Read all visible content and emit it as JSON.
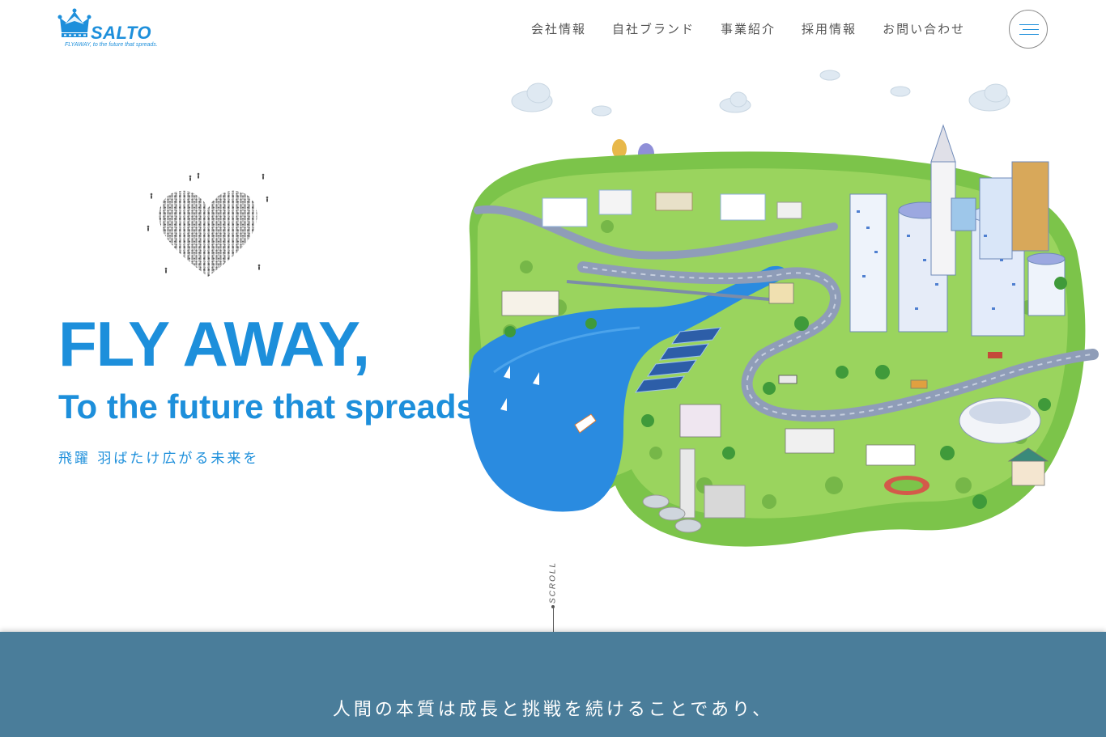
{
  "header": {
    "logo_text": "SALTO",
    "logo_tagline": "FLYAWAY, to the future that spreads.",
    "nav": [
      {
        "label": "会社情報"
      },
      {
        "label": "自社ブランド"
      },
      {
        "label": "事業紹介"
      },
      {
        "label": "採用情報"
      },
      {
        "label": "お問い合わせ"
      }
    ],
    "menu_icon": "hamburger-menu-icon"
  },
  "hero": {
    "title": "FLY AWAY,",
    "subtitle": "To the future that spreads.",
    "japanese": "飛躍 羽ばたけ広がる未来を",
    "heart_image": "heart-of-people-image",
    "city_image": "city-illustration-image"
  },
  "scroll": {
    "label": "SCROLL"
  },
  "band": {
    "text": "人間の本質は成長と挑戦を続けることであり、"
  },
  "colors": {
    "brand_blue": "#1d8fdb",
    "band_blue": "#4a7d9a",
    "nav_text": "#555555"
  }
}
